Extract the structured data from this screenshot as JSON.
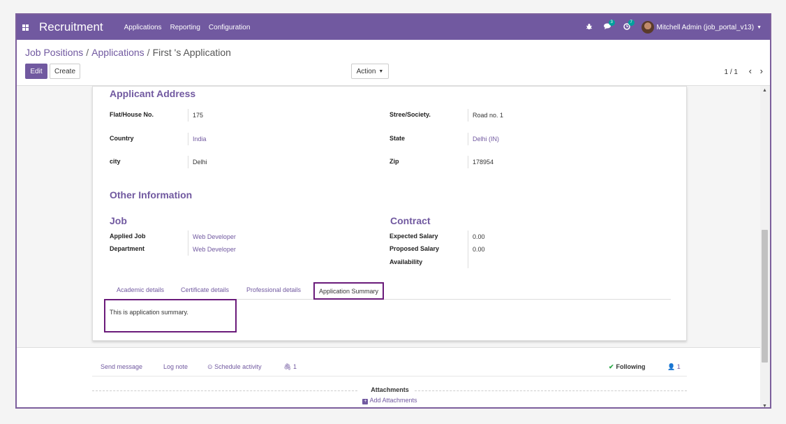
{
  "navbar": {
    "brand": "Recruitment",
    "menu": [
      "Applications",
      "Reporting",
      "Configuration"
    ],
    "chat_badge": "3",
    "activity_badge": "7",
    "user": "Mitchell Admin (job_portal_v13)"
  },
  "control": {
    "breadcrumb": [
      "Job Positions",
      "Applications",
      "First 's Application"
    ],
    "edit_label": "Edit",
    "create_label": "Create",
    "action_label": "Action",
    "pager": "1 / 1"
  },
  "address": {
    "title": "Applicant Address",
    "flat_label": "Flat/House No.",
    "flat_value": "175",
    "street_label": "Stree/Society.",
    "street_value": "Road no. 1",
    "country_label": "Country",
    "country_value": "India",
    "state_label": "State",
    "state_value": "Delhi (IN)",
    "city_label": "city",
    "city_value": "Delhi",
    "zip_label": "Zip",
    "zip_value": "178954"
  },
  "other": {
    "title": "Other Information",
    "job_title": "Job",
    "applied_job_label": "Applied Job",
    "applied_job_value": "Web Developer",
    "department_label": "Department",
    "department_value": "Web Developer",
    "contract_title": "Contract",
    "expected_label": "Expected Salary",
    "expected_value": "0.00",
    "proposed_label": "Proposed Salary",
    "proposed_value": "0.00",
    "availability_label": "Availability"
  },
  "tabs": {
    "items": [
      "Academic details",
      "Certificate details",
      "Professional details",
      "Application Summary"
    ],
    "active_content": "This is application summary."
  },
  "chatter": {
    "send_message": "Send message",
    "log_note": "Log note",
    "schedule_activity": "Schedule activity",
    "attachment_count": "1",
    "following": "Following",
    "followers_count": "1",
    "attachments_title": "Attachments",
    "add_attachments": "Add Attachments"
  },
  "colors": {
    "brand": "#7159a0",
    "highlight": "#6a1b7a"
  }
}
